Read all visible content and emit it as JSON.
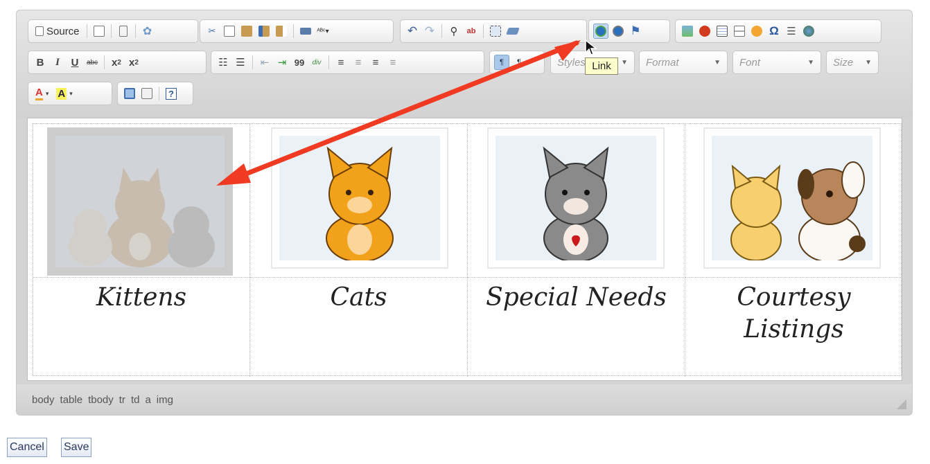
{
  "toolbar": {
    "source_label": "Source",
    "combos": {
      "styles": "Styles",
      "format": "Format",
      "font": "Font",
      "size": "Size"
    },
    "icons": [
      "source-icon",
      "preview-icon",
      "templates-icon",
      "hidden-fields-icon",
      "cut-icon",
      "copy-icon",
      "paste-icon",
      "paste-text-icon",
      "paste-word-icon",
      "print-icon",
      "spellcheck-icon",
      "undo-icon",
      "redo-icon",
      "find-icon",
      "replace-icon",
      "select-all-icon",
      "remove-format-icon",
      "link-icon",
      "unlink-icon",
      "anchor-icon",
      "image-icon",
      "flash-icon",
      "table-icon",
      "horizontal-rule-icon",
      "smiley-icon",
      "special-char-icon",
      "page-break-icon",
      "iframe-icon"
    ]
  },
  "format_labels": {
    "bold": "B",
    "italic": "I",
    "underline": "U",
    "strike": "abc",
    "subscript": "x",
    "sub_small": "2",
    "superscript": "x",
    "sup_small": "2",
    "blockquote": "99",
    "div": "div"
  },
  "tooltip": {
    "text": "Link"
  },
  "table": {
    "captions": [
      "Kittens",
      "Cats",
      "Special Needs",
      "Courtesy Listings"
    ],
    "caption_last_line1": "Courtesy",
    "caption_last_line2": "Listings"
  },
  "statusbar": {
    "path": [
      "body",
      "table",
      "tbody",
      "tr",
      "td",
      "a",
      "img"
    ]
  },
  "buttons": {
    "cancel": "Cancel",
    "save": "Save"
  },
  "colors": {
    "accent_arrow": "#f03a22",
    "tooltip_bg": "#ffffcc",
    "active_button": "#a9c8ea"
  }
}
